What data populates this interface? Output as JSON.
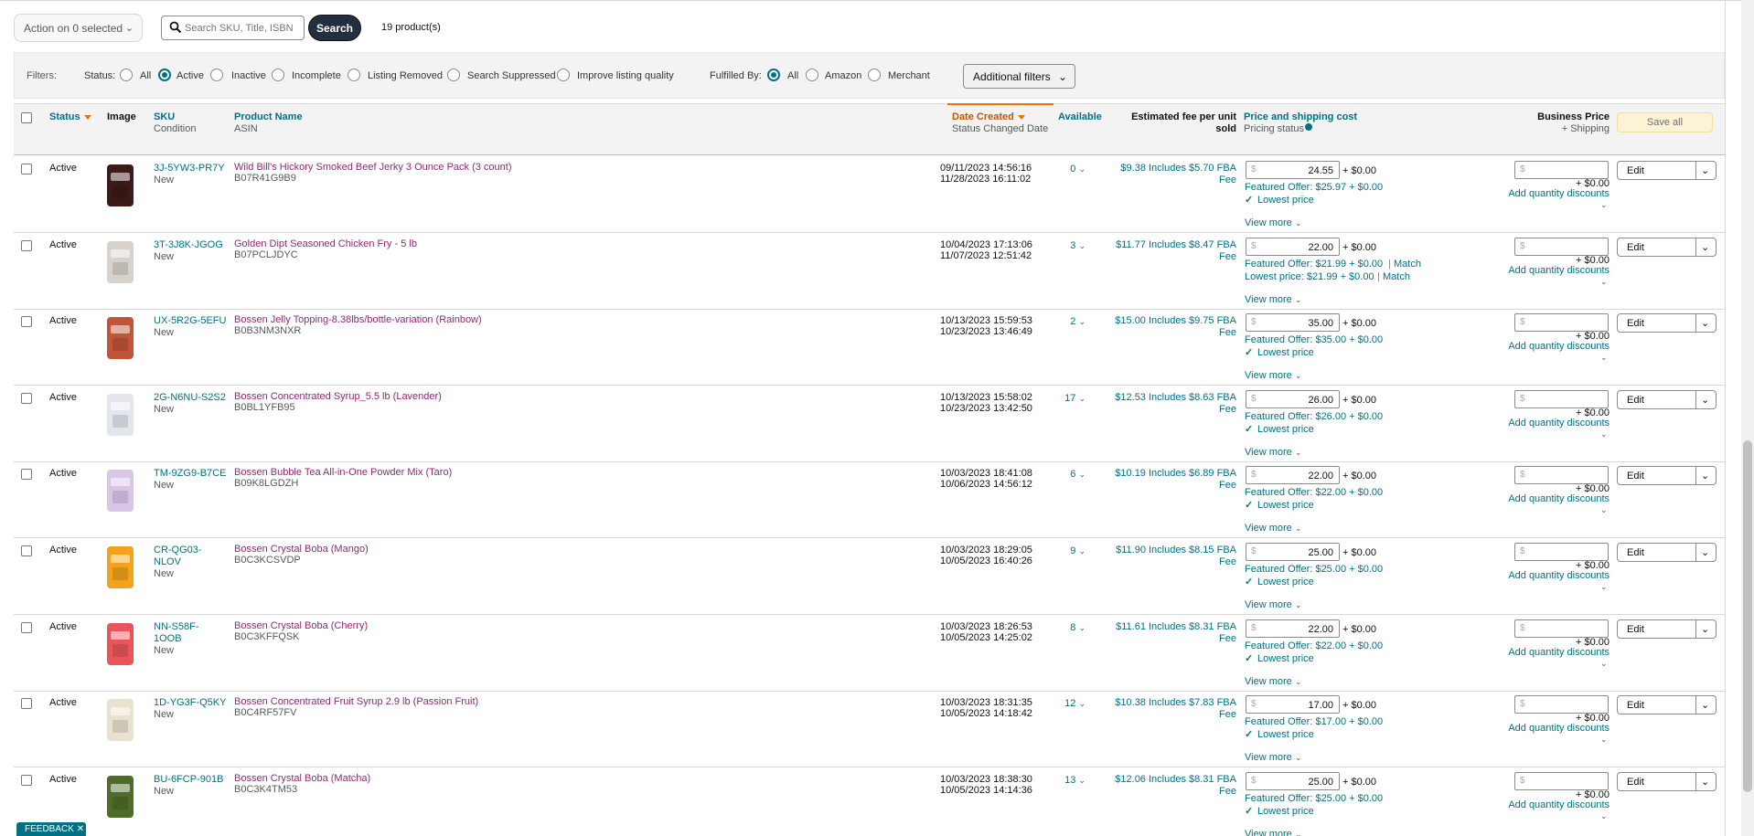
{
  "toolbar": {
    "action_label": "Action on 0 selected",
    "search_placeholder": "Search SKU, Title, ISBN",
    "search_button": "Search",
    "product_count": "19 product(s)"
  },
  "filters": {
    "label": "Filters:",
    "status_label": "Status:",
    "status_options": [
      "All",
      "Active",
      "Inactive",
      "Incomplete",
      "Listing Removed",
      "Search Suppressed",
      "Improve listing quality"
    ],
    "status_selected": "Active",
    "fulfilled_label": "Fulfilled By:",
    "fulfilled_options": [
      "All",
      "Amazon",
      "Merchant"
    ],
    "fulfilled_selected": "All",
    "additional_filters": "Additional filters"
  },
  "columns": {
    "status": "Status",
    "image": "Image",
    "sku": "SKU",
    "condition": "Condition",
    "product_name": "Product Name",
    "asin": "ASIN",
    "date_created": "Date Created",
    "status_changed": "Status Changed Date",
    "available": "Available",
    "fee_line1": "Estimated fee per unit",
    "fee_line2": "sold",
    "price": "Price and shipping cost",
    "pricing_status": "Pricing status",
    "business_price": "Business Price",
    "shipping": "+ Shipping",
    "save_all": "Save all"
  },
  "labels": {
    "shipping_add": "+ $0.00",
    "lowest_price": "Lowest price",
    "view_more": "View more",
    "add_quantity_discounts": "Add quantity discounts",
    "edit": "Edit",
    "match": "Match",
    "currency": "$",
    "feedback": "FEEDBACK"
  },
  "rows": [
    {
      "status": "Active",
      "sku": "3J-5YW3-PR7Y",
      "condition": "New",
      "name": "Wild Bill's Hickory Smoked Beef Jerky 3 Ounce Pack (3 count)",
      "asin": "B07R41G9B9",
      "created": "09/11/2023 14:56:16",
      "changed": "11/28/2023 16:11:02",
      "available": "0",
      "fee1": "$9.38 Includes $5.70 FBA",
      "fee2": "Fee",
      "price": "24.55",
      "featured": "Featured Offer: $25.97 + $0.00",
      "lowest_line": "",
      "img_color": "#3b1b18"
    },
    {
      "status": "Active",
      "sku": "3T-3J8K-JGOG",
      "condition": "New",
      "name": "Golden Dipt Seasoned Chicken Fry - 5 lb",
      "asin": "B07PCLJDYC",
      "created": "10/04/2023 17:13:06",
      "changed": "11/07/2023 12:51:42",
      "available": "3",
      "fee1": "$11.77 Includes $8.47 FBA",
      "fee2": "Fee",
      "price": "22.00",
      "featured": "Featured Offer: $21.99 + $0.00",
      "lowest_line": "Lowest price: $21.99 + $0.00",
      "img_color": "#d8d2cc"
    },
    {
      "status": "Active",
      "sku": "UX-5R2G-5EFU",
      "condition": "New",
      "name": "Bossen Jelly Topping-8.38lbs/bottle-variation (Rainbow)",
      "asin": "B0B3NM3NXR",
      "created": "10/13/2023 15:59:53",
      "changed": "10/23/2023 13:46:49",
      "available": "2",
      "fee1": "$15.00 Includes $9.75 FBA",
      "fee2": "Fee",
      "price": "35.00",
      "featured": "Featured Offer: $35.00 + $0.00",
      "lowest_line": "",
      "img_color": "#c0553a"
    },
    {
      "status": "Active",
      "sku": "2G-N6NU-S2S2",
      "condition": "New",
      "name": "Bossen Concentrated Syrup_5.5 lb (Lavender)",
      "asin": "B0BL1YFB95",
      "created": "10/13/2023 15:58:02",
      "changed": "10/23/2023 13:42:50",
      "available": "17",
      "fee1": "$12.53 Includes $8.63 FBA",
      "fee2": "Fee",
      "price": "26.00",
      "featured": "Featured Offer: $26.00 + $0.00",
      "lowest_line": "",
      "img_color": "#e4e6ee"
    },
    {
      "status": "Active",
      "sku": "TM-9ZG9-B7CE",
      "condition": "New",
      "name": "Bossen Bubble Tea All-in-One Powder Mix (Taro)",
      "asin": "B09K8LGDZH",
      "created": "10/03/2023 18:41:08",
      "changed": "10/06/2023 14:56:12",
      "available": "6",
      "fee1": "$10.19 Includes $6.89 FBA",
      "fee2": "Fee",
      "price": "22.00",
      "featured": "Featured Offer: $22.00 + $0.00",
      "lowest_line": "",
      "img_color": "#d9c6e6"
    },
    {
      "status": "Active",
      "sku": "CR-QG03-",
      "sku2": "NLOV",
      "condition": "New",
      "name": "Bossen Crystal Boba (Mango)",
      "asin": "B0C3KCSVDP",
      "created": "10/03/2023 18:29:05",
      "changed": "10/05/2023 16:40:26",
      "available": "9",
      "fee1": "$11.90 Includes $8.15 FBA",
      "fee2": "Fee",
      "price": "25.00",
      "featured": "Featured Offer: $25.00 + $0.00",
      "lowest_line": "",
      "img_color": "#f2a31b"
    },
    {
      "status": "Active",
      "sku": "NN-S58F-",
      "sku2": "1OOB",
      "condition": "New",
      "name": "Bossen Crystal Boba (Cherry)",
      "asin": "B0C3KFFQSK",
      "created": "10/03/2023 18:26:53",
      "changed": "10/05/2023 14:25:02",
      "available": "8",
      "fee1": "$11.61 Includes $8.31 FBA",
      "fee2": "Fee",
      "price": "22.00",
      "featured": "Featured Offer: $22.00 + $0.00",
      "lowest_line": "",
      "img_color": "#e8565a"
    },
    {
      "status": "Active",
      "sku": "1D-YG3F-Q5KY",
      "condition": "New",
      "name": "Bossen Concentrated Fruit Syrup 2.9 lb (Passion Fruit)",
      "asin": "B0C4RF57FV",
      "created": "10/03/2023 18:31:35",
      "changed": "10/05/2023 14:18:42",
      "available": "12",
      "fee1": "$10.38 Includes $7.83 FBA",
      "fee2": "Fee",
      "price": "17.00",
      "featured": "Featured Offer: $17.00 + $0.00",
      "lowest_line": "",
      "img_color": "#e8e2cf"
    },
    {
      "status": "Active",
      "sku": "BU-6FCP-901B",
      "condition": "New",
      "name": "Bossen Crystal Boba (Matcha)",
      "asin": "B0C3K4TM53",
      "created": "10/03/2023 18:38:30",
      "changed": "10/05/2023 14:14:36",
      "available": "13",
      "fee1": "$12.06 Includes $8.31 FBA",
      "fee2": "Fee",
      "price": "25.00",
      "featured": "Featured Offer: $25.00 + $0.00",
      "lowest_line": "",
      "img_color": "#4e6b2a"
    }
  ]
}
